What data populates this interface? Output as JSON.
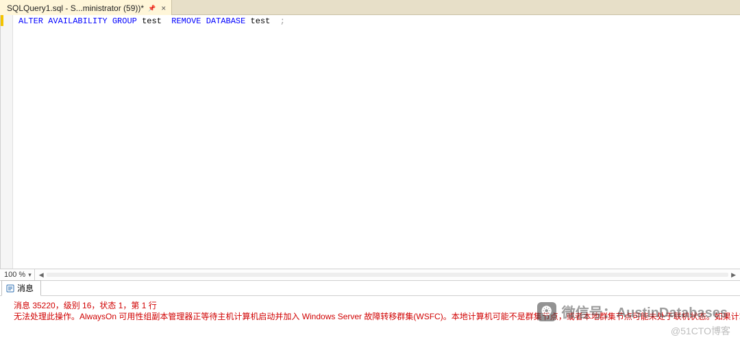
{
  "tab": {
    "title": "SQLQuery1.sql - S...ministrator (59))*",
    "pin_icon": "📌",
    "close_label": "×"
  },
  "sql": {
    "kw_alter": "ALTER",
    "kw_availability": "AVAILABILITY",
    "kw_group": "GROUP",
    "ident_test1": "test",
    "kw_remove": "REMOVE",
    "kw_database": "DATABASE",
    "ident_test2": "test",
    "semicolon": ";"
  },
  "zoom": {
    "value": "100 %",
    "dropdown_icon": "▾",
    "left_arrow": "◀",
    "right_arrow": "▶"
  },
  "messages_tab": {
    "label": "消息"
  },
  "messages": {
    "line1": "消息 35220，级别 16，状态 1，第 1 行",
    "line2": "无法处理此操作。AlwaysOn 可用性组副本管理器正等待主机计算机启动并加入 Windows Server 故障转移群集(WSFC)。本地计算机可能不是群集节点，或者本地群集节点可能未处于联机状态。如果计算机是群集节点，请等待"
  },
  "watermark": {
    "icon": "❂",
    "text": "微信号：AustinDatabases"
  },
  "credit": "@51CTO博客"
}
